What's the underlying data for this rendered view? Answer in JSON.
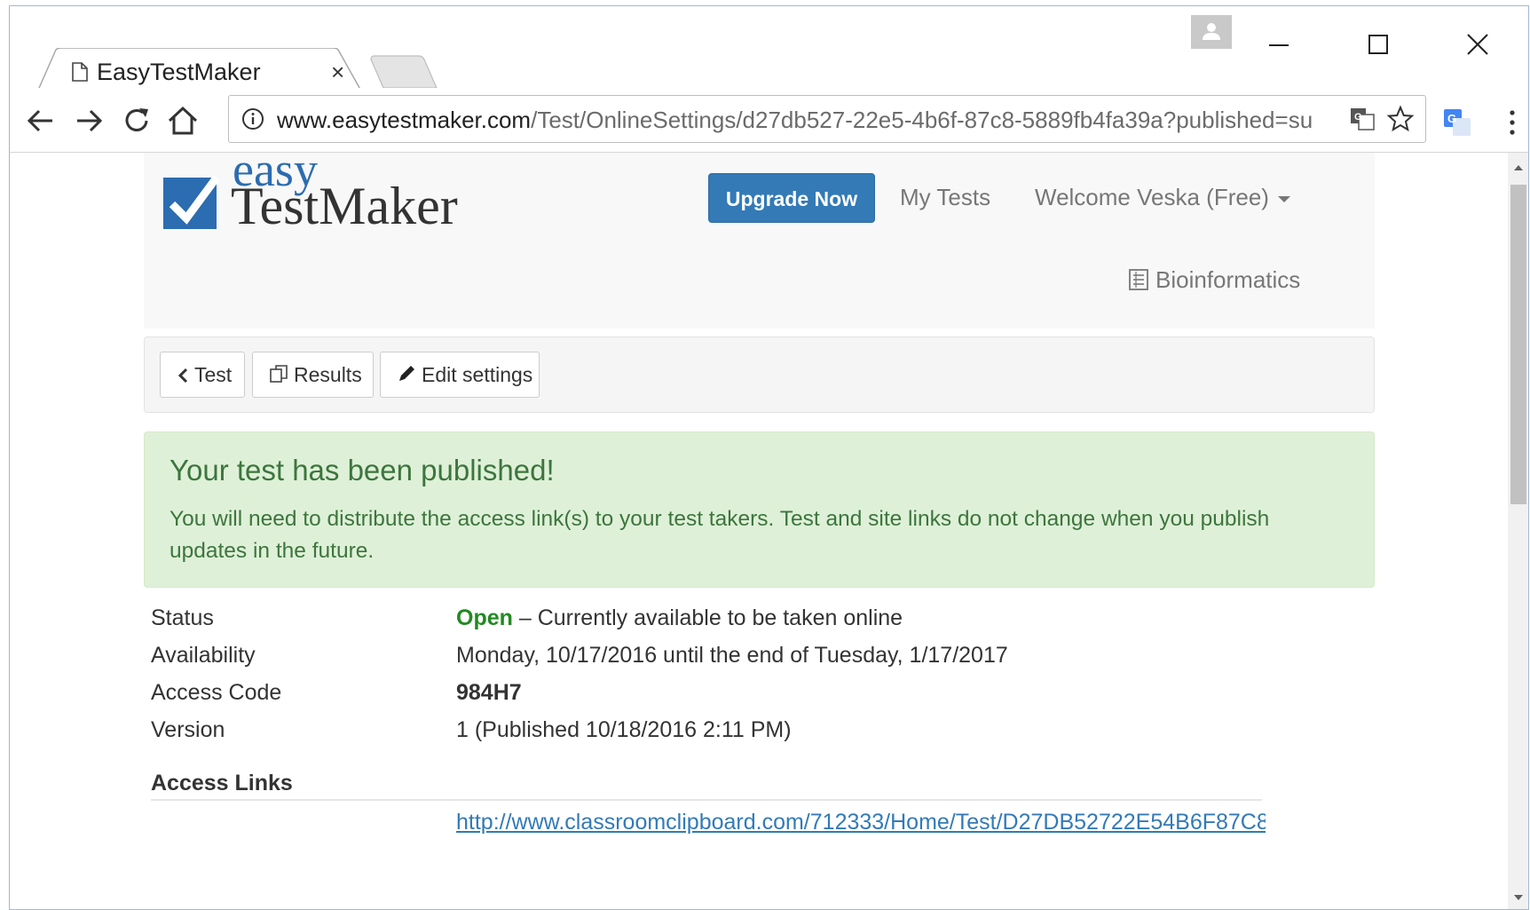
{
  "browser": {
    "tab_title": "EasyTestMaker",
    "tab_close": "×",
    "url_host": "www.easytestmaker.com",
    "url_path": "/Test/OnlineSettings/d27db527-22e5-4b6f-87c8-5889fb4fa39a?published=su",
    "accent": "#4285f4"
  },
  "header": {
    "logo_easy": "easy",
    "logo_testmaker": "TestMaker",
    "upgrade_label": "Upgrade Now",
    "my_tests_label": "My Tests",
    "welcome_label": "Welcome Veska (Free)",
    "test_name": "Bioinformatics"
  },
  "subnav": {
    "back_label": "Test",
    "results_label": "Results",
    "edit_label": "Edit settings"
  },
  "alert": {
    "title": "Your test has been published!",
    "body": "You will need to distribute the access link(s) to your test takers. Test and site links do not change when you publish updates in the future.",
    "color": "#3c763d",
    "background": "#dff0d8"
  },
  "details": {
    "status_label": "Status",
    "status_value": "Open",
    "status_note": " – Currently available to be taken online",
    "availability_label": "Availability",
    "availability_value": "Monday, 10/17/2016 until the end of Tuesday, 1/17/2017",
    "access_code_label": "Access Code",
    "access_code_value": "984H7",
    "version_label": "Version",
    "version_value": "1 (Published 10/18/2016 2:11 PM)",
    "access_links_title": "Access Links",
    "access_link": "http://www.classroomclipboard.com/712333/Home/Test/D27DB52722E54B6F87C8"
  },
  "colors": {
    "primary_button": "#337ab7",
    "status_open": "#218a21"
  }
}
